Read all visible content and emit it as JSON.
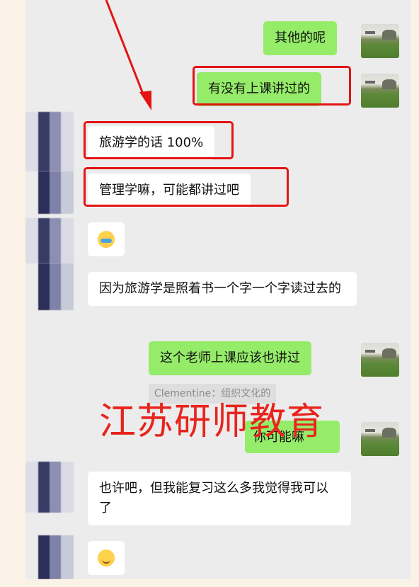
{
  "messages": {
    "out_1": "其他的呢",
    "out_2": "有没有上课讲过的",
    "in_1": "旅游学的话 100%",
    "in_2": "管理学嘛，可能都讲过吧",
    "in_4": "因为旅游学是照着书一个字一个字读过去的",
    "out_3": "这个老师上课应该也讲过",
    "system_tag": "Clementine：组织文化的",
    "out_4": "你可能嘛",
    "in_5": "也许吧，但我能复习这么多我觉得我可以了"
  },
  "emoji": {
    "in_3": "crying-laughing-emoji",
    "in_6": "smiling-emoji"
  },
  "watermark": "江苏研师教育",
  "colors": {
    "outgoing_bubble": "#95ec69",
    "incoming_bubble": "#ffffff",
    "chat_background": "#ececec",
    "highlight": "#e31414",
    "watermark": "#e8241d"
  }
}
